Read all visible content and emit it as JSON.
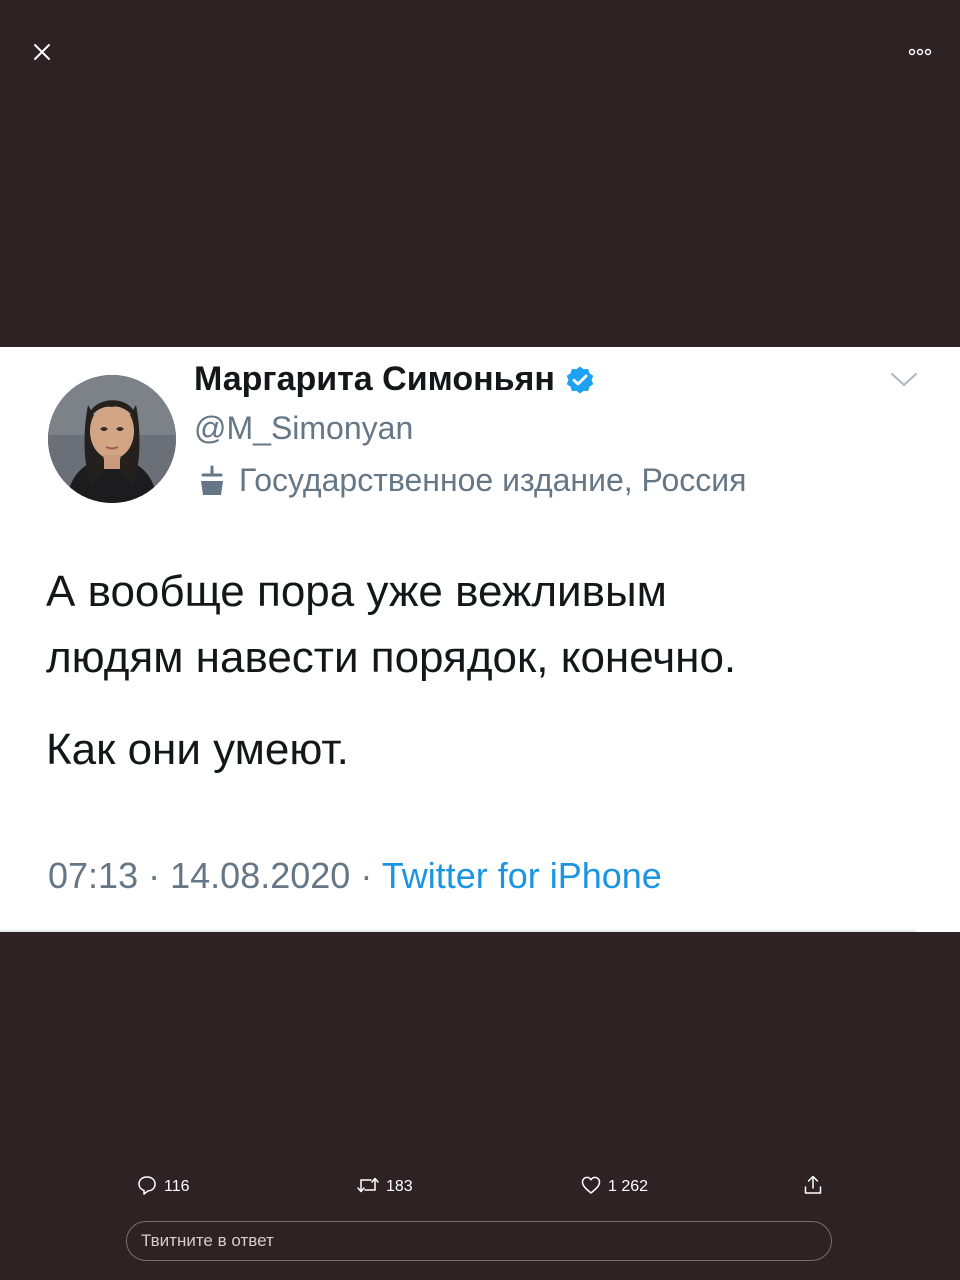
{
  "viewer": {
    "close_icon": "close-icon",
    "more_icon": "more-options-icon"
  },
  "tweet": {
    "author_name": "Маргарита Симоньян",
    "handle": "@M_Simonyan",
    "state_label": "Государственное издание, Россия",
    "text_lines": [
      "А вообще пора уже вежливым",
      "людям навести порядок, конечно.",
      "Как они умеют."
    ],
    "time": "07:13",
    "separator": "·",
    "date": "14.08.2020",
    "source": "Twitter for iPhone"
  },
  "actions": {
    "reply_count": "116",
    "retweet_count": "183",
    "like_count": "1 262"
  },
  "reply_box": {
    "placeholder": "Твитните в ответ"
  },
  "colors": {
    "background": "#2f2222",
    "card": "#ffffff",
    "text": "#14171a",
    "secondary": "#657786",
    "link": "#1b95e0",
    "verified": "#1da1f2"
  }
}
